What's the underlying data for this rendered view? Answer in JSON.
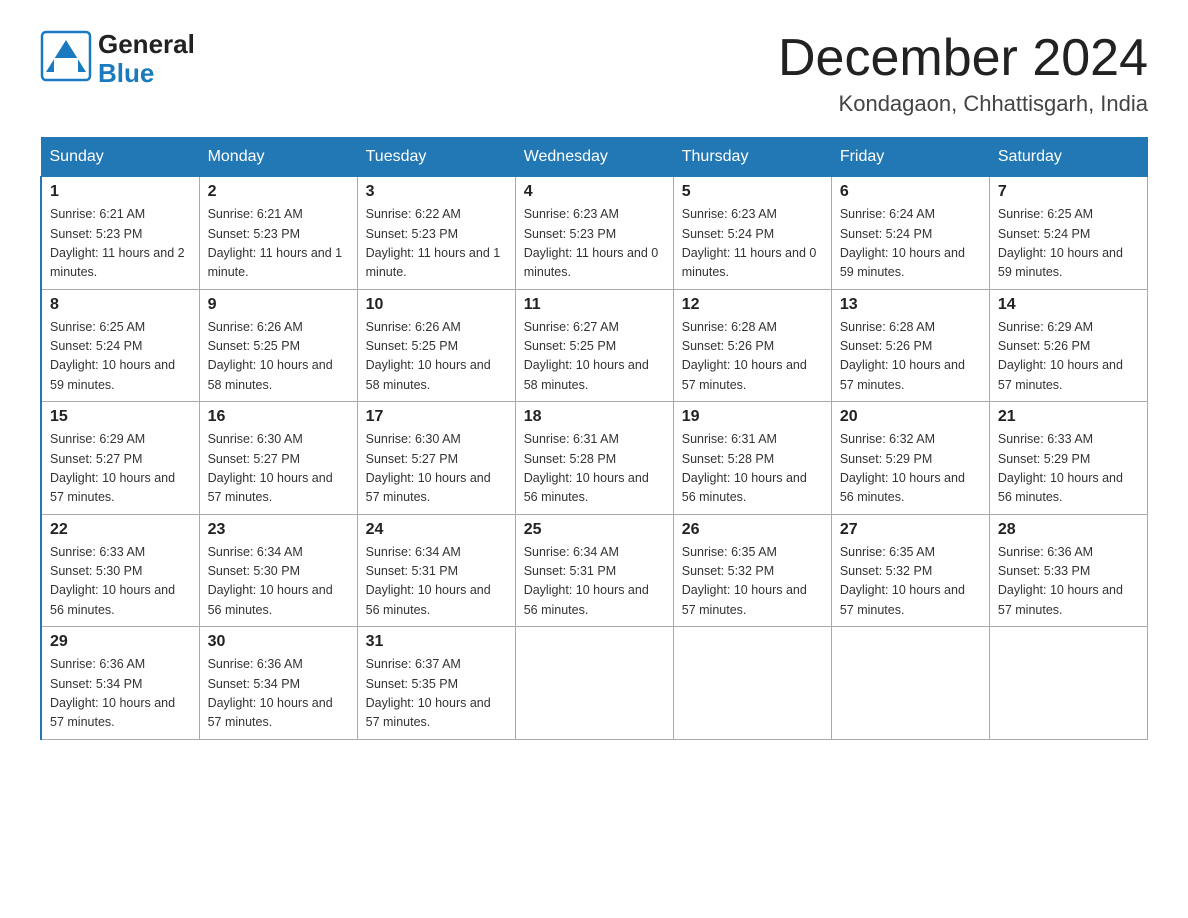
{
  "logo": {
    "general": "General",
    "blue": "Blue"
  },
  "title": "December 2024",
  "location": "Kondagaon, Chhattisgarh, India",
  "days_of_week": [
    "Sunday",
    "Monday",
    "Tuesday",
    "Wednesday",
    "Thursday",
    "Friday",
    "Saturday"
  ],
  "weeks": [
    [
      {
        "day": "1",
        "sunrise": "6:21 AM",
        "sunset": "5:23 PM",
        "daylight": "11 hours and 2 minutes."
      },
      {
        "day": "2",
        "sunrise": "6:21 AM",
        "sunset": "5:23 PM",
        "daylight": "11 hours and 1 minute."
      },
      {
        "day": "3",
        "sunrise": "6:22 AM",
        "sunset": "5:23 PM",
        "daylight": "11 hours and 1 minute."
      },
      {
        "day": "4",
        "sunrise": "6:23 AM",
        "sunset": "5:23 PM",
        "daylight": "11 hours and 0 minutes."
      },
      {
        "day": "5",
        "sunrise": "6:23 AM",
        "sunset": "5:24 PM",
        "daylight": "11 hours and 0 minutes."
      },
      {
        "day": "6",
        "sunrise": "6:24 AM",
        "sunset": "5:24 PM",
        "daylight": "10 hours and 59 minutes."
      },
      {
        "day": "7",
        "sunrise": "6:25 AM",
        "sunset": "5:24 PM",
        "daylight": "10 hours and 59 minutes."
      }
    ],
    [
      {
        "day": "8",
        "sunrise": "6:25 AM",
        "sunset": "5:24 PM",
        "daylight": "10 hours and 59 minutes."
      },
      {
        "day": "9",
        "sunrise": "6:26 AM",
        "sunset": "5:25 PM",
        "daylight": "10 hours and 58 minutes."
      },
      {
        "day": "10",
        "sunrise": "6:26 AM",
        "sunset": "5:25 PM",
        "daylight": "10 hours and 58 minutes."
      },
      {
        "day": "11",
        "sunrise": "6:27 AM",
        "sunset": "5:25 PM",
        "daylight": "10 hours and 58 minutes."
      },
      {
        "day": "12",
        "sunrise": "6:28 AM",
        "sunset": "5:26 PM",
        "daylight": "10 hours and 57 minutes."
      },
      {
        "day": "13",
        "sunrise": "6:28 AM",
        "sunset": "5:26 PM",
        "daylight": "10 hours and 57 minutes."
      },
      {
        "day": "14",
        "sunrise": "6:29 AM",
        "sunset": "5:26 PM",
        "daylight": "10 hours and 57 minutes."
      }
    ],
    [
      {
        "day": "15",
        "sunrise": "6:29 AM",
        "sunset": "5:27 PM",
        "daylight": "10 hours and 57 minutes."
      },
      {
        "day": "16",
        "sunrise": "6:30 AM",
        "sunset": "5:27 PM",
        "daylight": "10 hours and 57 minutes."
      },
      {
        "day": "17",
        "sunrise": "6:30 AM",
        "sunset": "5:27 PM",
        "daylight": "10 hours and 57 minutes."
      },
      {
        "day": "18",
        "sunrise": "6:31 AM",
        "sunset": "5:28 PM",
        "daylight": "10 hours and 56 minutes."
      },
      {
        "day": "19",
        "sunrise": "6:31 AM",
        "sunset": "5:28 PM",
        "daylight": "10 hours and 56 minutes."
      },
      {
        "day": "20",
        "sunrise": "6:32 AM",
        "sunset": "5:29 PM",
        "daylight": "10 hours and 56 minutes."
      },
      {
        "day": "21",
        "sunrise": "6:33 AM",
        "sunset": "5:29 PM",
        "daylight": "10 hours and 56 minutes."
      }
    ],
    [
      {
        "day": "22",
        "sunrise": "6:33 AM",
        "sunset": "5:30 PM",
        "daylight": "10 hours and 56 minutes."
      },
      {
        "day": "23",
        "sunrise": "6:34 AM",
        "sunset": "5:30 PM",
        "daylight": "10 hours and 56 minutes."
      },
      {
        "day": "24",
        "sunrise": "6:34 AM",
        "sunset": "5:31 PM",
        "daylight": "10 hours and 56 minutes."
      },
      {
        "day": "25",
        "sunrise": "6:34 AM",
        "sunset": "5:31 PM",
        "daylight": "10 hours and 56 minutes."
      },
      {
        "day": "26",
        "sunrise": "6:35 AM",
        "sunset": "5:32 PM",
        "daylight": "10 hours and 57 minutes."
      },
      {
        "day": "27",
        "sunrise": "6:35 AM",
        "sunset": "5:32 PM",
        "daylight": "10 hours and 57 minutes."
      },
      {
        "day": "28",
        "sunrise": "6:36 AM",
        "sunset": "5:33 PM",
        "daylight": "10 hours and 57 minutes."
      }
    ],
    [
      {
        "day": "29",
        "sunrise": "6:36 AM",
        "sunset": "5:34 PM",
        "daylight": "10 hours and 57 minutes."
      },
      {
        "day": "30",
        "sunrise": "6:36 AM",
        "sunset": "5:34 PM",
        "daylight": "10 hours and 57 minutes."
      },
      {
        "day": "31",
        "sunrise": "6:37 AM",
        "sunset": "5:35 PM",
        "daylight": "10 hours and 57 minutes."
      },
      null,
      null,
      null,
      null
    ]
  ],
  "labels": {
    "sunrise": "Sunrise:",
    "sunset": "Sunset:",
    "daylight": "Daylight:"
  }
}
